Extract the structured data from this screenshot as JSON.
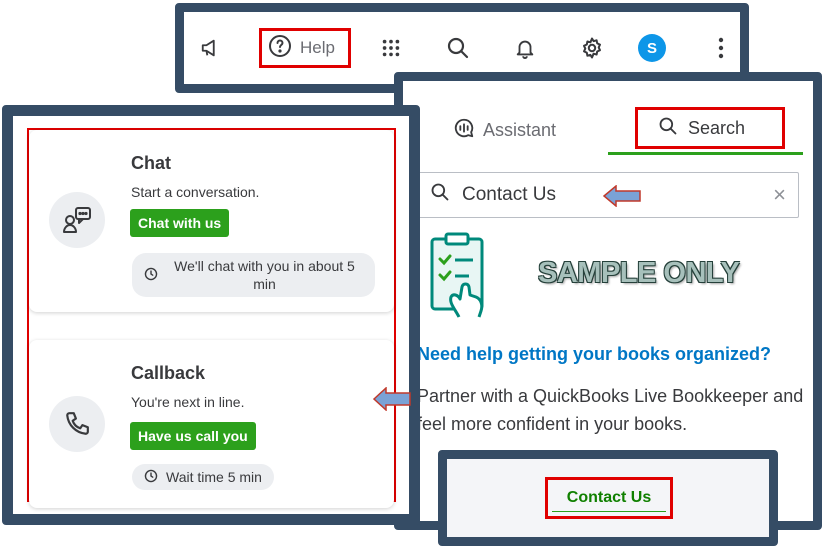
{
  "toolbar": {
    "help_label": "Help",
    "avatar_initial": "S"
  },
  "help_panel": {
    "tabs": [
      {
        "label": "Assistant",
        "active": false
      },
      {
        "label": "Search",
        "active": true
      }
    ],
    "search": {
      "value": "Contact Us",
      "clear_glyph": "×"
    },
    "watermark": "SAMPLE ONLY",
    "promo_title": "Need help getting your books organized?",
    "promo_body": "Partner with a QuickBooks Live Bookkeeper and feel more confident in your books."
  },
  "contact_panel": {
    "button_label": "Contact Us"
  },
  "options": {
    "chat": {
      "title": "Chat",
      "subtitle": "Start a conversation.",
      "button_label": "Chat with us",
      "wait_text": "We'll chat with you in about 5 min"
    },
    "callback": {
      "title": "Callback",
      "subtitle": "You're next in line.",
      "button_label": "Have us call you",
      "wait_text": "Wait time 5 min"
    }
  },
  "colors": {
    "frame": "#354c65",
    "highlight": "#e00000",
    "brand_green": "#2ca01c",
    "link_blue": "#0077c5",
    "avatar_blue": "#0d96e8",
    "arrow_fill": "#7aa2d6"
  },
  "icons": [
    "megaphone-icon",
    "help-circle-icon",
    "apps-grid-icon",
    "search-icon",
    "bell-icon",
    "gear-icon",
    "more-vertical-icon",
    "assistant-icon",
    "clear-icon",
    "clipboard-illustration",
    "chat-icon",
    "phone-icon",
    "clock-icon",
    "arrow-annotation"
  ]
}
